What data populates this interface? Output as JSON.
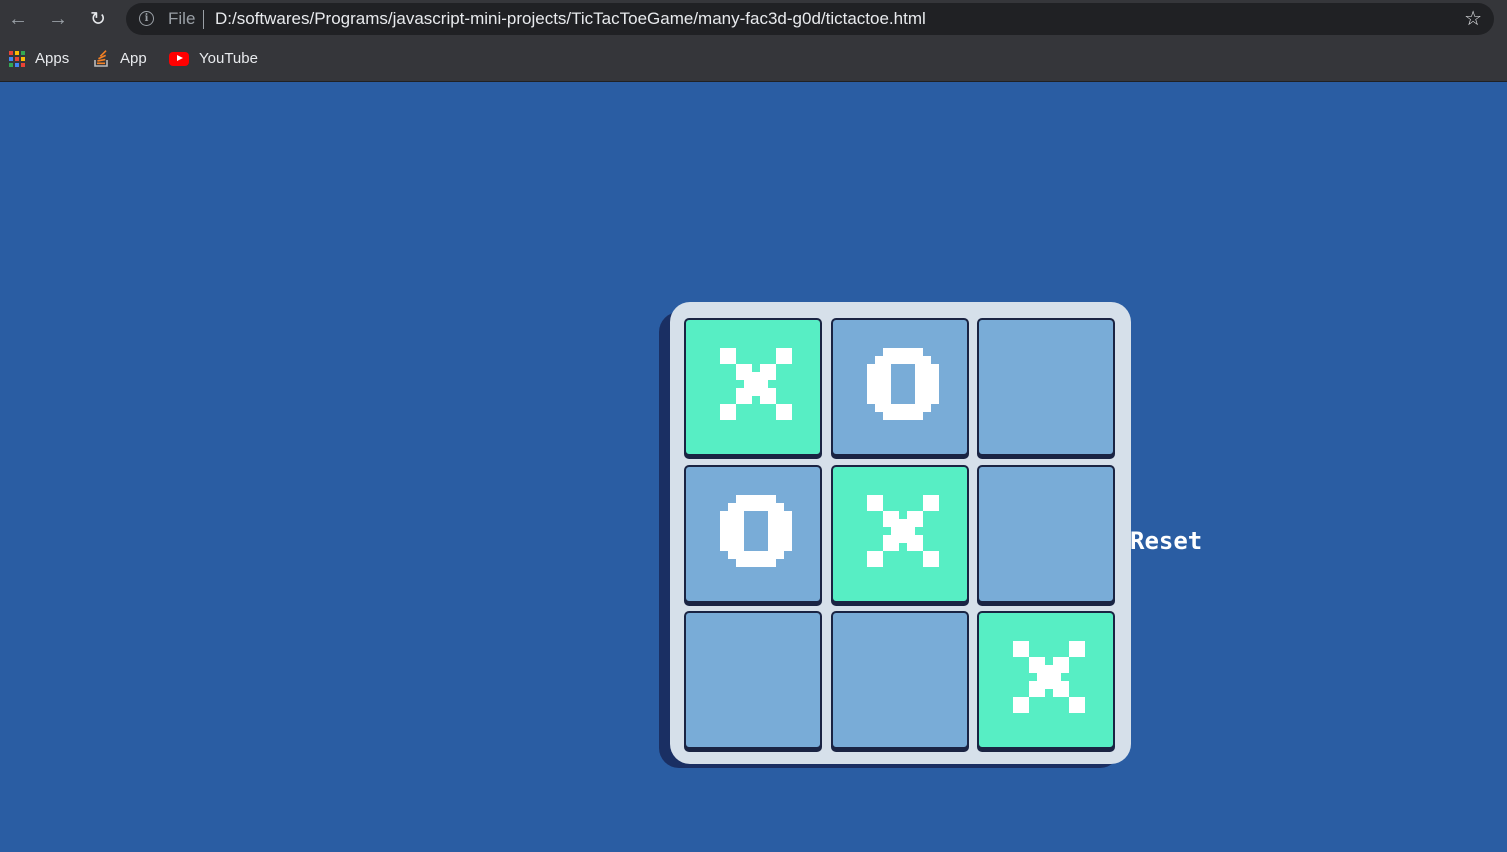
{
  "browser": {
    "file_label": "File",
    "url": "D:/softwares/Programs/javascript-mini-projects/TicTacToeGame/many-fac3d-g0d/tictactoe.html",
    "bookmarks": [
      {
        "label": "Apps",
        "icon": "apps-grid-icon"
      },
      {
        "label": "App",
        "icon": "stackoverflow-icon"
      },
      {
        "label": "YouTube",
        "icon": "youtube-icon"
      }
    ]
  },
  "game": {
    "cells": [
      "X",
      "O",
      "",
      "O",
      "X",
      "",
      "",
      "",
      "X"
    ],
    "reset_label": "Reset",
    "colors": {
      "background": "#2a5da3",
      "board": "#d6e0ea",
      "cell_empty": "#79acd7",
      "cell_x": "#57eec4",
      "mark": "#ffffff"
    }
  }
}
